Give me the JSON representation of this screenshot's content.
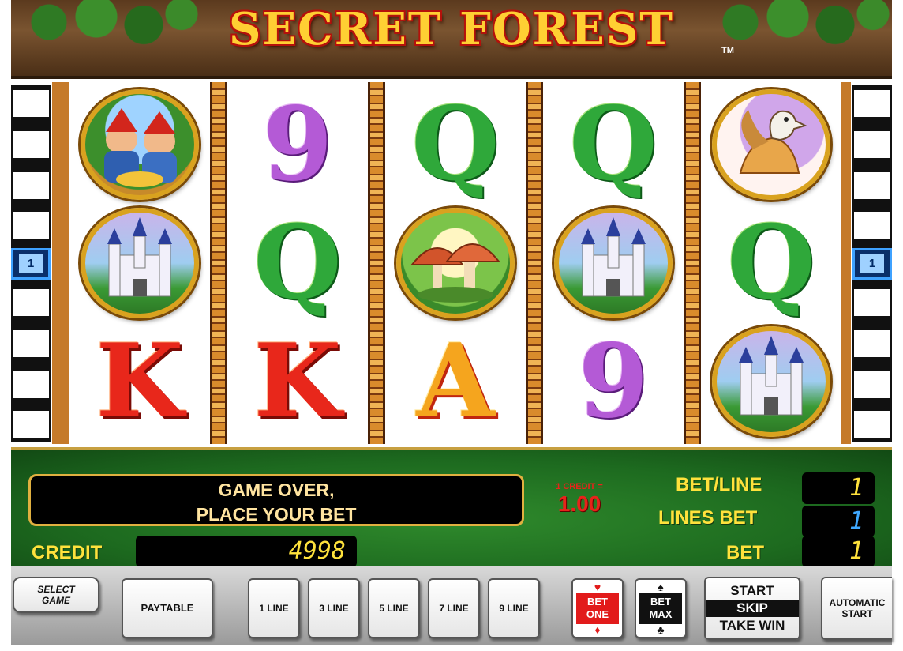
{
  "game": {
    "title": "SECRET FOREST",
    "trademark": "TM"
  },
  "line_markers": {
    "left": "1",
    "right": "1"
  },
  "reels": [
    [
      "dwarves-symbol",
      "castle-symbol",
      "K"
    ],
    [
      "9",
      "Q",
      "K"
    ],
    [
      "Q",
      "mushroom-symbol",
      "A"
    ],
    [
      "Q",
      "castle-symbol",
      "9"
    ],
    [
      "griffin-symbol",
      "Q",
      "castle-symbol"
    ]
  ],
  "console": {
    "message_line1": "GAME OVER,",
    "message_line2": "PLACE YOUR BET",
    "credit_rate_label": "1 CREDIT =",
    "credit_rate_value": "1.00",
    "credit_label": "CREDIT",
    "credit_value": "4998",
    "bet_per_line_label": "BET/LINE",
    "bet_per_line_value": "1",
    "lines_bet_label": "LINES BET",
    "lines_bet_value": "1",
    "bet_label": "BET",
    "bet_value": "1"
  },
  "buttons": {
    "select_game_1": "SELECT",
    "select_game_2": "GAME",
    "paytable": "PAYTABLE",
    "line_1": "1 LINE",
    "line_3": "3 LINE",
    "line_5": "5 LINE",
    "line_7": "7 LINE",
    "line_9": "9 LINE",
    "bet_one_1": "BET",
    "bet_one_2": "ONE",
    "bet_max_1": "BET",
    "bet_max_2": "MAX",
    "start": "START",
    "skip": "SKIP",
    "take_win": "TAKE WIN",
    "auto_1": "AUTOMATIC",
    "auto_2": "START"
  },
  "colors": {
    "reel_frame": "#c57a2a",
    "console_green": "#1d6a1f",
    "label_yellow": "#ffe23c",
    "credit_red": "#e8231a",
    "lines_blue": "#3fa8ff"
  }
}
